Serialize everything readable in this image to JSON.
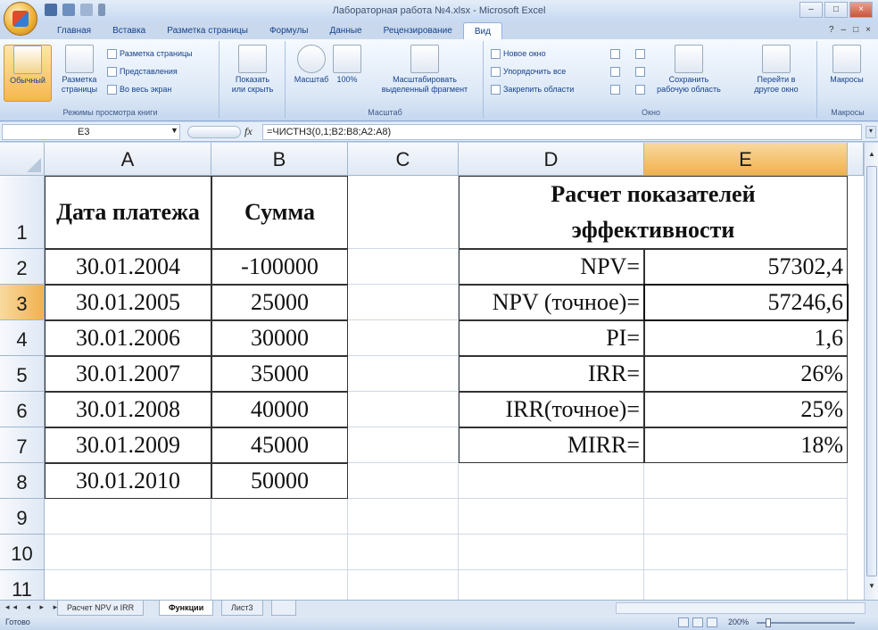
{
  "window": {
    "title": "Лабораторная работа №4.xlsx - Microsoft Excel",
    "controls": [
      "–",
      "□",
      "×"
    ]
  },
  "ribbon": {
    "tabs": [
      "Главная",
      "Вставка",
      "Разметка страницы",
      "Формулы",
      "Данные",
      "Рецензирование",
      "Вид"
    ],
    "active_tab": "Вид",
    "group_views": {
      "label": "Режимы просмотра книги",
      "normal": "Обычный",
      "page_layout": "Разметка страницы",
      "page_break": "Разметка страницы",
      "custom_views": "Представления",
      "full_screen": "Во весь экран"
    },
    "group_show": {
      "show_hide": "Показать или скрыть"
    },
    "group_zoom": {
      "label": "Масштаб",
      "zoom": "Масштаб",
      "zoom_100": "100%",
      "zoom_selection": "Масштабировать выделенный фрагмент"
    },
    "group_window": {
      "label": "Окно",
      "new_window": "Новое окно",
      "arrange_all": "Упорядочить все",
      "freeze_panes": "Закрепить области",
      "save_workspace": "Сохранить рабочую область",
      "switch_windows": "Перейти в другое окно"
    },
    "group_macros": {
      "label": "Макросы",
      "macros": "Макросы"
    }
  },
  "formula_bar": {
    "name_box": "E3",
    "fx": "fx",
    "formula": "=ЧИСТНЗ(0,1;B2:B8;A2:A8)"
  },
  "grid": {
    "columns": [
      "A",
      "B",
      "C",
      "D",
      "E"
    ],
    "rows": [
      "1",
      "2",
      "3",
      "4",
      "5",
      "6",
      "7",
      "8",
      "9",
      "10",
      "11"
    ],
    "header_date": "Дата платежа",
    "header_sum": "Сумма",
    "header_calc": "Расчет показателей эффективности",
    "dates": [
      "30.01.2004",
      "30.01.2005",
      "30.01.2006",
      "30.01.2007",
      "30.01.2008",
      "30.01.2009",
      "30.01.2010"
    ],
    "sums": [
      "-100000",
      "25000",
      "30000",
      "35000",
      "40000",
      "45000",
      "50000"
    ],
    "metric_labels": [
      "NPV=",
      "NPV (точное)=",
      "PI=",
      "IRR=",
      "IRR(точное)=",
      "MIRR="
    ],
    "metric_values": [
      "57302,4",
      "57246,6",
      "1,6",
      "26%",
      "25%",
      "18%"
    ]
  },
  "sheets": {
    "tabs": [
      "Расчет NPV и IRR",
      "Функции",
      "Лист3"
    ],
    "active": "Функции"
  },
  "status": {
    "ready": "Готово",
    "zoom": "200%"
  }
}
